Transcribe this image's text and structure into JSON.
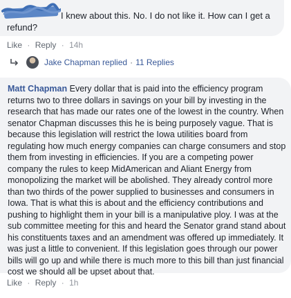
{
  "top_comment": {
    "text": "I knew about this. No. I do not like it. How can I get a refund?",
    "actions": {
      "like": "Like",
      "reply": "Reply",
      "separator": "·",
      "time": "14h"
    }
  },
  "replies_summary": {
    "name": "Jake Chapman replied",
    "separator": "·",
    "count": "11 Replies"
  },
  "main_comment": {
    "author": "Matt Chapman",
    "text": "Every dollar that is paid into the efficiency program returns two to three dollars in savings on your bill by investing in the research that has made our rates one of the lowest in the country. When senator Chapman discusses this he is being purposely vague. That is because this legislation will restrict the Iowa utilities board from regulating how much energy companies can charge consumers and stop them from investing in efficiencies. If you are a competing power company the rules to keep MidAmerican and Aliant Energy from monopolizing the market will be abolished. They already control more than two thirds of the power supplied to businesses and consumers in Iowa. That is what this is about and the efficiency contributions and pushing to highlight them in your bill is a manipulative ploy. I was at the sub committee meeting for this and heard the Senator grand stand about his constituents taxes and an amendment was offered up immediately. It was just a little to convenient. If this legislation goes through our power bills will go up and while there is much more to this bill than just financial cost we should all be upset about that.",
    "actions": {
      "like": "Like",
      "reply": "Reply",
      "separator": "·",
      "time": "1h"
    }
  },
  "colors": {
    "bubble": "#f2f3f5",
    "link": "#385898",
    "meta": "#90949c",
    "text": "#1d2129",
    "redaction": "#5b86c6"
  }
}
